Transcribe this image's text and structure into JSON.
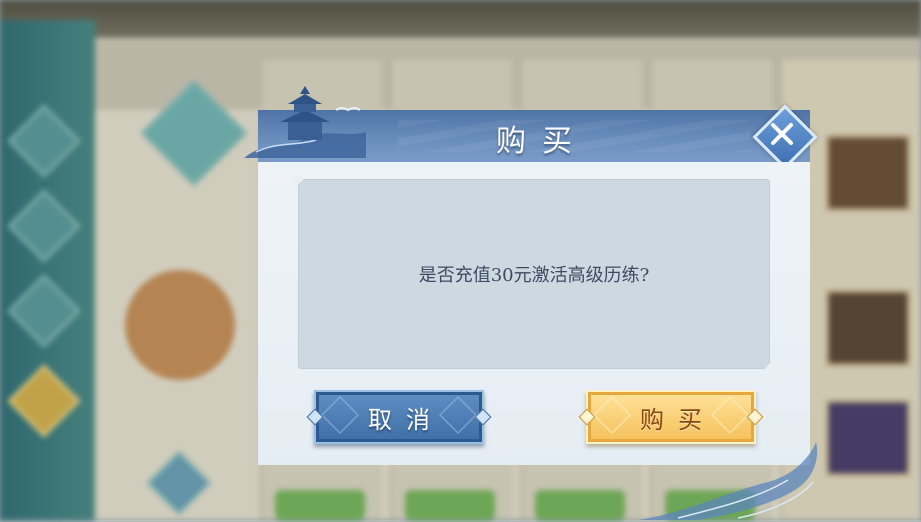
{
  "dialog": {
    "title": "购买",
    "message": "是否充值30元激活高级历练?",
    "cancel_label": "取消",
    "buy_label": "购买"
  },
  "colors": {
    "header_blue": "#5a7db0",
    "cancel_blue": "#4a7bb2",
    "buy_gold": "#f6c863",
    "text_dark": "#3c4b63"
  },
  "icons": {
    "close": "close-icon",
    "pavilion": "pavilion-icon",
    "wave": "wave-decoration-icon"
  }
}
